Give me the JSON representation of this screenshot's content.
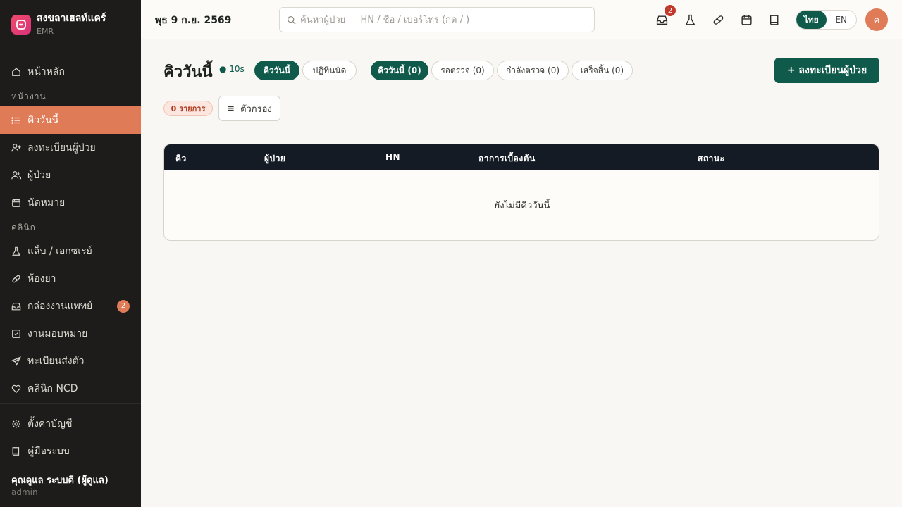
{
  "brand": {
    "name": "สงขลาเฮลท์แคร์",
    "sub": "EMR"
  },
  "sidebar": {
    "home": "หน้าหลัก",
    "section_work": "หน้างาน",
    "items_work": [
      {
        "label": "คิววันนี้",
        "icon": "list-icon"
      },
      {
        "label": "ลงทะเบียนผู้ป่วย",
        "icon": "user-plus-icon"
      },
      {
        "label": "ผู้ป่วย",
        "icon": "users-icon"
      },
      {
        "label": "นัดหมาย",
        "icon": "calendar-icon"
      }
    ],
    "section_clinic": "คลินิก",
    "items_clinic": [
      {
        "label": "แล็บ / เอกซเรย์",
        "icon": "flask-icon"
      },
      {
        "label": "ห้องยา",
        "icon": "pill-icon"
      },
      {
        "label": "กล่องงานแพทย์",
        "icon": "inbox-icon",
        "badge": "2"
      },
      {
        "label": "งานมอบหมาย",
        "icon": "checkbox-icon"
      },
      {
        "label": "ทะเบียนส่งตัว",
        "icon": "send-icon"
      },
      {
        "label": "คลินิก NCD",
        "icon": "heart-icon"
      }
    ],
    "settings": "ตั้งค่าบัญชี",
    "manual": "คู่มือระบบ",
    "user_name": "คุณดูแล ระบบดี (ผู้ดูแล)",
    "user_role": "admin"
  },
  "topbar": {
    "date": "พุธ 9 ก.ย. 2569",
    "search_placeholder": "ค้นหาผู้ป่วย — HN / ชื่อ / เบอร์โทร (กด / )",
    "inbox_badge": "2",
    "lang_th": "ไทย",
    "lang_en": "EN",
    "avatar": "ค"
  },
  "main": {
    "title": "คิววันนี้",
    "live": "● 10s",
    "view_tabs": [
      "คิววันนี้",
      "ปฏิทินนัด"
    ],
    "status_tabs": [
      "คิววันนี้ (0)",
      "รอตรวจ (0)",
      "กำลังตรวจ (0)",
      "เสร็จสิ้น (0)"
    ],
    "register_button": "+ ลงทะเบียนผู้ป่วย",
    "count_badge": "0 รายการ",
    "filter_button": "ตัวกรอง",
    "filter_icon": "≡",
    "table_headers": [
      "คิว",
      "ผู้ป่วย",
      "HN",
      "อาการเบื้องต้น",
      "สถานะ"
    ],
    "empty_text": "ยังไม่มีคิววันนี้"
  },
  "colors": {
    "accent": "#0f5a4a",
    "active_nav": "#e07b58",
    "sidebar_bg": "#1d1c1a",
    "table_header": "#141b24"
  }
}
